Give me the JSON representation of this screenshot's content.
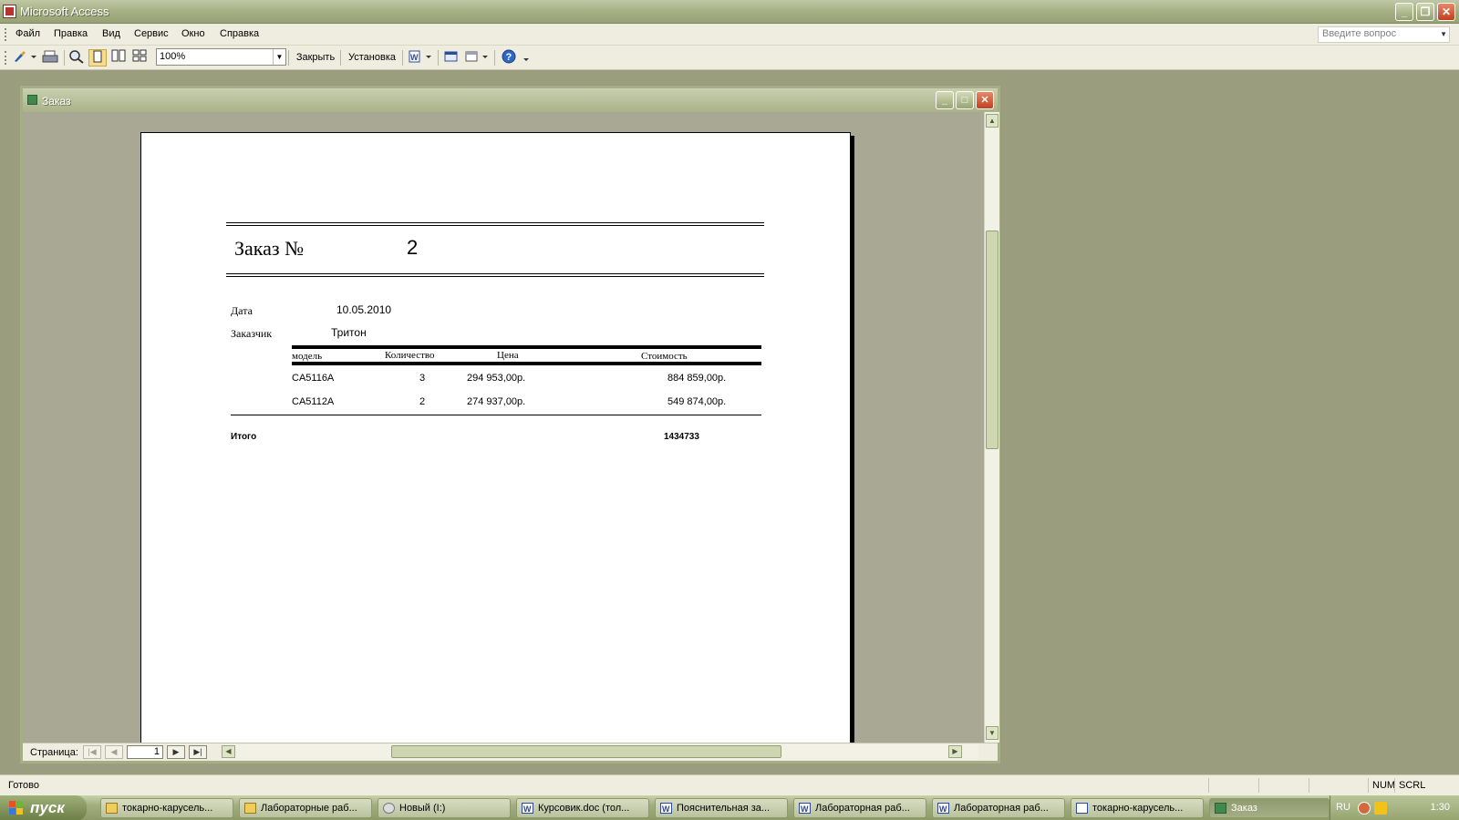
{
  "window": {
    "title": "Microsoft Access"
  },
  "menu": {
    "items": [
      {
        "label": "Файл"
      },
      {
        "label": "Правка"
      },
      {
        "label": "Вид"
      },
      {
        "label": "Сервис"
      },
      {
        "label": "Окно"
      },
      {
        "label": "Справка"
      }
    ],
    "ask_placeholder": "Введите вопрос"
  },
  "toolbar": {
    "zoom": "100%",
    "close_label": "Закрыть",
    "setup_label": "Установка"
  },
  "document": {
    "title": "Заказ",
    "report": {
      "heading": "Заказ №",
      "number": "2",
      "date_label": "Дата",
      "date_value": "10.05.2010",
      "customer_label": "Заказчик",
      "customer_value": "Тритон",
      "columns": [
        "модель",
        "Количество",
        "Цена",
        "Стоимость"
      ],
      "rows": [
        {
          "model": "CA5116A",
          "qty": "3",
          "price": "294 953,00р.",
          "cost": "884 859,00р."
        },
        {
          "model": "CA5112A",
          "qty": "2",
          "price": "274 937,00р.",
          "cost": "549 874,00р."
        }
      ],
      "total_label": "Итого",
      "total_value": "1434733"
    },
    "nav": {
      "label": "Страница:",
      "page": "1"
    }
  },
  "status": {
    "text": "Готово",
    "num": "NUM",
    "scrl": "SCRL"
  },
  "taskbar": {
    "start_label": "пуск",
    "tasks": [
      {
        "label": "токарно-карусель..."
      },
      {
        "label": "Лабораторные раб..."
      },
      {
        "label": "Новый (I:)"
      },
      {
        "label": "Курсовик.doc (тол..."
      },
      {
        "label": "Пояснительная за..."
      },
      {
        "label": "Лабораторная раб..."
      },
      {
        "label": "Лабораторная раб..."
      },
      {
        "label": "токарно-карусель..."
      },
      {
        "label": "Заказ"
      }
    ],
    "lang": "RU",
    "clock": "1:30"
  }
}
